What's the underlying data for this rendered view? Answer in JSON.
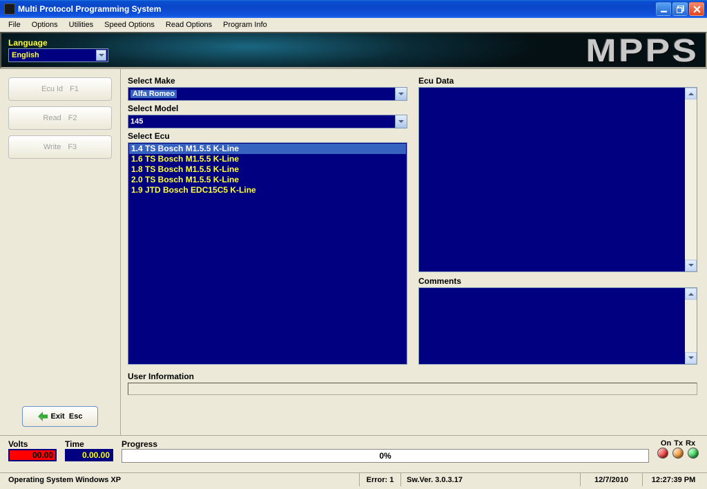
{
  "title": "Multi Protocol Programming System",
  "menu": [
    "File",
    "Options",
    "Utilities",
    "Speed Options",
    "Read Options",
    "Program Info"
  ],
  "banner": {
    "lang_label": "Language",
    "lang_value": "English",
    "brand": "MPPS"
  },
  "sidebar": {
    "ecu_id": "Ecu Id",
    "ecu_id_key": "F1",
    "read": "Read",
    "read_key": "F2",
    "write": "Write",
    "write_key": "F3",
    "exit": "Exit",
    "exit_key": "Esc"
  },
  "labels": {
    "select_make": "Select Make",
    "select_model": "Select Model",
    "select_ecu": "Select Ecu",
    "ecu_data": "Ecu Data",
    "comments": "Comments",
    "user_info": "User Information",
    "volts": "Volts",
    "time": "Time",
    "progress": "Progress",
    "on": "On",
    "tx": "Tx",
    "rx": "Rx"
  },
  "make_value": "Alfa Romeo",
  "model_value": "145",
  "ecu_list": [
    "1.4 TS Bosch M1.5.5 K-Line",
    "1.6 TS Bosch M1.5.5 K-Line",
    "1.8 TS Bosch M1.5.5 K-Line",
    "2.0 TS Bosch M1.5.5 K-Line",
    "1.9 JTD Bosch EDC15C5 K-Line"
  ],
  "status": {
    "volts": "00.00",
    "time": "0.00.00",
    "progress_pct": "0%",
    "os": "Operating System Windows XP",
    "error": "Error: 1",
    "version": "Sw.Ver. 3.0.3.17",
    "date": "12/7/2010",
    "clock": "12:27:39 PM"
  }
}
